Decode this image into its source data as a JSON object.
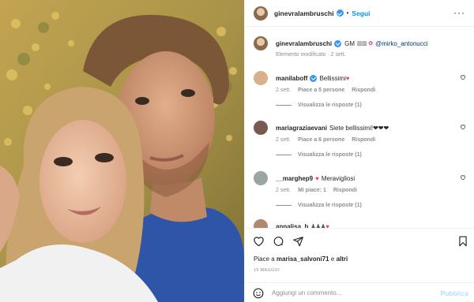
{
  "post": {
    "username": "ginevralambruschi",
    "follow_label": "Segui",
    "separator": "•",
    "caption_username": "ginevralambruschi",
    "caption_text": "GM",
    "caption_mention": "@mirko_antonucci",
    "caption_meta": "Elemento modificato · 2 sett."
  },
  "comments": [
    {
      "username": "manilaboff",
      "text": "Bellissimi",
      "verified": true,
      "emoji": "♥",
      "time": "2 sett.",
      "likes": "Piace a 5 persone",
      "reply": "Rispondi",
      "view_replies": "Visualizza le risposte (1)",
      "avatar_color": "#d9b08c"
    },
    {
      "username": "mariagraziaevani",
      "text": "Siete bellissimi!❤❤❤",
      "verified": false,
      "emoji": "",
      "time": "2 sett.",
      "likes": "Piace a 6 persone",
      "reply": "Rispondi",
      "view_replies": "Visualizza le risposte (1)",
      "avatar_color": "#7a5a50"
    },
    {
      "username": "__marghep9",
      "text": "Meravigliosi",
      "verified": false,
      "emoji": "♥",
      "time": "2 sett.",
      "likes": "Mi piace: 1",
      "reply": "Rispondi",
      "view_replies": "Visualizza le risposte (1)",
      "avatar_color": "#9aa7a0"
    },
    {
      "username": "annalisa_b",
      "text": "",
      "verified": false,
      "emoji": "",
      "time": "",
      "likes": "",
      "reply": "",
      "view_replies": "",
      "avatar_color": "#b08a70"
    }
  ],
  "footer": {
    "likes_prefix": "Piace a",
    "likes_user": "marisa_salvoni71",
    "likes_suffix": "e",
    "likes_others": "altri",
    "date": "15 MAGGIO",
    "comment_placeholder": "Aggiungi un commento...",
    "publish_label": "Pubblica"
  },
  "colors": {
    "accent": "#0095f6",
    "verified": "#3897f0",
    "heart": "#ed4956",
    "muted": "#8e8e8e"
  },
  "icons": [
    "more-options-icon",
    "like-icon",
    "comment-icon",
    "share-icon",
    "bookmark-icon",
    "emoji-icon",
    "verified-badge-icon"
  ]
}
